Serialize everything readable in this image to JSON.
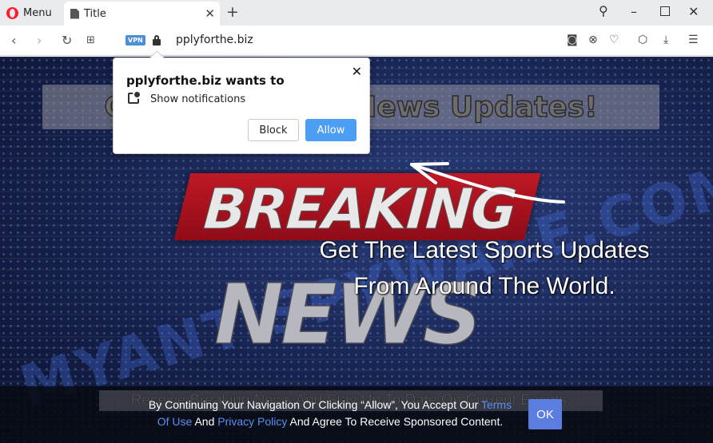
{
  "browser": {
    "menu_label": "Menu",
    "tab_title": "Title",
    "url": "pplyforthe.biz",
    "vpn_label": "VPN"
  },
  "page": {
    "headline": "Get The Latest News Updates!",
    "breaking_label": "BREAKING",
    "news_label": "NEWS",
    "watermark": "MYANTISPYWARE.COM",
    "sports_line1": "Get The Latest Sports Updates",
    "sports_line2": "From Around The World."
  },
  "footer": {
    "background_text": "Receive Breaking News And Stay Up To Date On Current Events.",
    "text_before_terms": "By Continuing Your Navigation Or Clicking “Allow”, You Accept Our ",
    "terms_link": "Terms Of Use",
    "text_and": " And ",
    "privacy_link": "Privacy Policy",
    "text_after": " And Agree To Receive Sponsored Content.",
    "ok_label": "OK"
  },
  "popup": {
    "title": "pplyforthe.biz wants to",
    "message": "Show notifications",
    "block_label": "Block",
    "allow_label": "Allow"
  },
  "colors": {
    "opera_red": "#ff1b2d",
    "allow_blue": "#4c9ef5",
    "breaking_red": "#c01825",
    "page_navy": "#16224d",
    "link_blue": "#5b8ef0"
  }
}
